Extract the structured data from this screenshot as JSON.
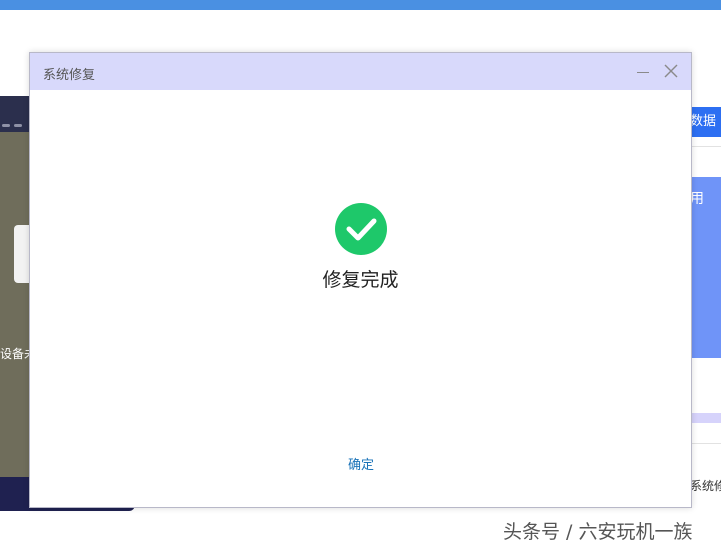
{
  "dialog": {
    "title": "系统修复",
    "message": "修复完成",
    "confirm_label": "确定"
  },
  "background_left": {
    "text": "设备未"
  },
  "background_right": {
    "button_label": "数据",
    "panel_text": "用",
    "bottom_text": "系统修"
  },
  "watermark": "头条号 / 六安玩机一族",
  "colors": {
    "success": "#1ec86a",
    "title_bar": "#d8d9fb",
    "link": "#1a73b8",
    "top_bar": "#4a90e2"
  }
}
